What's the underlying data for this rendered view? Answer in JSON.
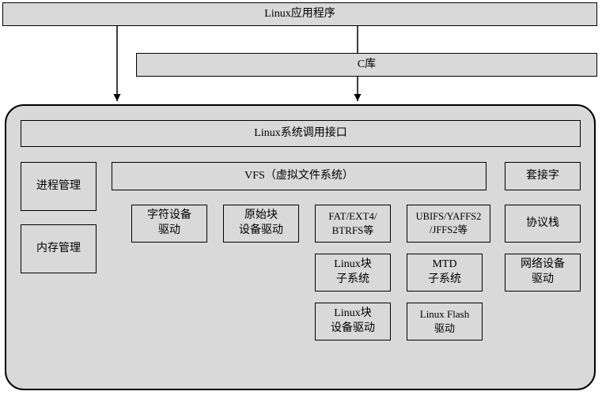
{
  "top": {
    "app": "Linux应用程序",
    "clib": "C库"
  },
  "kernel": {
    "syscall": "Linux系统调用接口",
    "left": {
      "proc": "进程管理",
      "mem": "内存管理"
    },
    "vfs": {
      "title": "VFS（虚拟文件系统）",
      "row1": {
        "char": "字符设备\n驱动",
        "rawblk": "原始块\n设备驱动",
        "fs": "FAT/EXT4/\nBTRFS等",
        "flashfs": "UBIFS/YAFFS2\n/JFFS2等"
      },
      "row2": {
        "blksub": "Linux块\n子系统",
        "mtd": "MTD\n子系统"
      },
      "row3": {
        "blkdrv": "Linux块\n设备驱动",
        "flashdrv": "Linux Flash\n驱动"
      }
    },
    "net": {
      "socket": "套接字",
      "proto": "协议栈",
      "netdev": "网络设备\n驱动"
    }
  },
  "chart_data": {
    "type": "diagram",
    "title": "Linux system architecture (applications → C library → kernel subsystems)",
    "nodes": [
      {
        "id": "app",
        "label": "Linux应用程序"
      },
      {
        "id": "clib",
        "label": "C库"
      },
      {
        "id": "syscall",
        "label": "Linux系统调用接口"
      },
      {
        "id": "proc",
        "label": "进程管理"
      },
      {
        "id": "mem",
        "label": "内存管理"
      },
      {
        "id": "vfs",
        "label": "VFS（虚拟文件系统）"
      },
      {
        "id": "char",
        "label": "字符设备驱动"
      },
      {
        "id": "rawblk",
        "label": "原始块设备驱动"
      },
      {
        "id": "fs",
        "label": "FAT/EXT4/BTRFS等"
      },
      {
        "id": "flashfs",
        "label": "UBIFS/YAFFS2/JFFS2等"
      },
      {
        "id": "blksub",
        "label": "Linux块子系统"
      },
      {
        "id": "mtd",
        "label": "MTD子系统"
      },
      {
        "id": "blkdrv",
        "label": "Linux块设备驱动"
      },
      {
        "id": "flashdrv",
        "label": "Linux Flash驱动"
      },
      {
        "id": "socket",
        "label": "套接字"
      },
      {
        "id": "proto",
        "label": "协议栈"
      },
      {
        "id": "netdev",
        "label": "网络设备驱动"
      }
    ],
    "edges": [
      {
        "from": "app",
        "to": "syscall"
      },
      {
        "from": "app",
        "to": "clib"
      },
      {
        "from": "clib",
        "to": "syscall"
      }
    ]
  }
}
